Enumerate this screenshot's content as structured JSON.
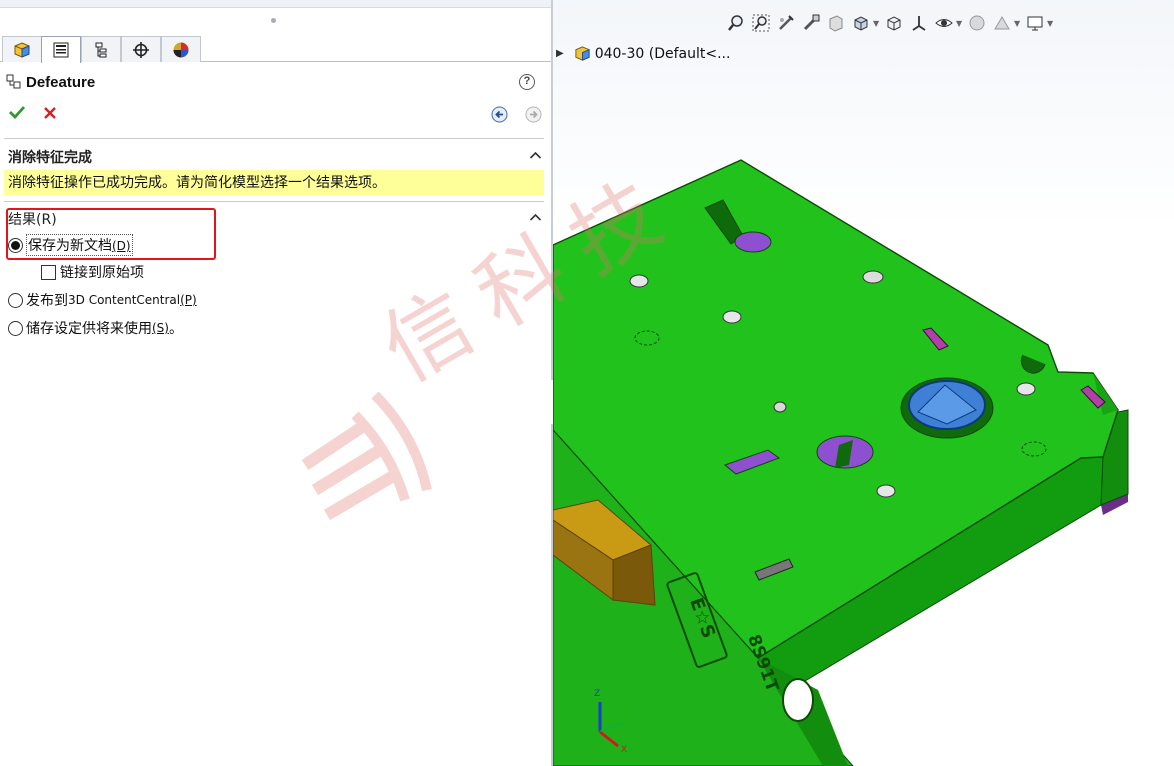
{
  "panel": {
    "title": "Defeature",
    "help_label": "?",
    "tabs": [
      "feature-manager",
      "property-manager",
      "configuration-manager",
      "dimxpert-manager",
      "display-manager"
    ]
  },
  "message_group": {
    "title": "消除特征完成",
    "message": "消除特征操作已成功完成。请为简化模型选择一个结果选项。"
  },
  "result_group": {
    "title": "结果(R)",
    "options": [
      {
        "label": "保存为新文档",
        "mnemonic": "(D)",
        "selected": true
      },
      {
        "label": "发布到 ",
        "label_latin": "3D ContentCentral",
        "mnemonic": "(P)",
        "selected": false
      },
      {
        "label": "储存设定供将来使用",
        "mnemonic": "(S)",
        "suffix": "。",
        "selected": false
      }
    ],
    "link_checkbox": {
      "label": "链接到原始项",
      "checked": false
    }
  },
  "graphics": {
    "tree_item": "040-30  (Default<...",
    "part_marking": "E☆S",
    "part_number": "8S91T",
    "axes": {
      "x": "X",
      "y": "Y",
      "z": "Z"
    },
    "hud_icons": [
      "zoom-to-fit-icon",
      "zoom-to-area-icon",
      "previous-view-icon",
      "section-view-icon",
      "dynamic-annotation-icon",
      "view-orientation-icon",
      "display-style-icon",
      "hide-show-icon",
      "edit-appearance-icon",
      "apply-scene-icon",
      "view-settings-icon"
    ],
    "colors": {
      "part_body": "#22c21d",
      "part_edge": "#0c4a06",
      "bolt": "#c99a14",
      "accent_purple": "#8e4fd0",
      "hole_blue": "#3f7fd6"
    }
  },
  "watermark": {
    "text": "信科技"
  }
}
